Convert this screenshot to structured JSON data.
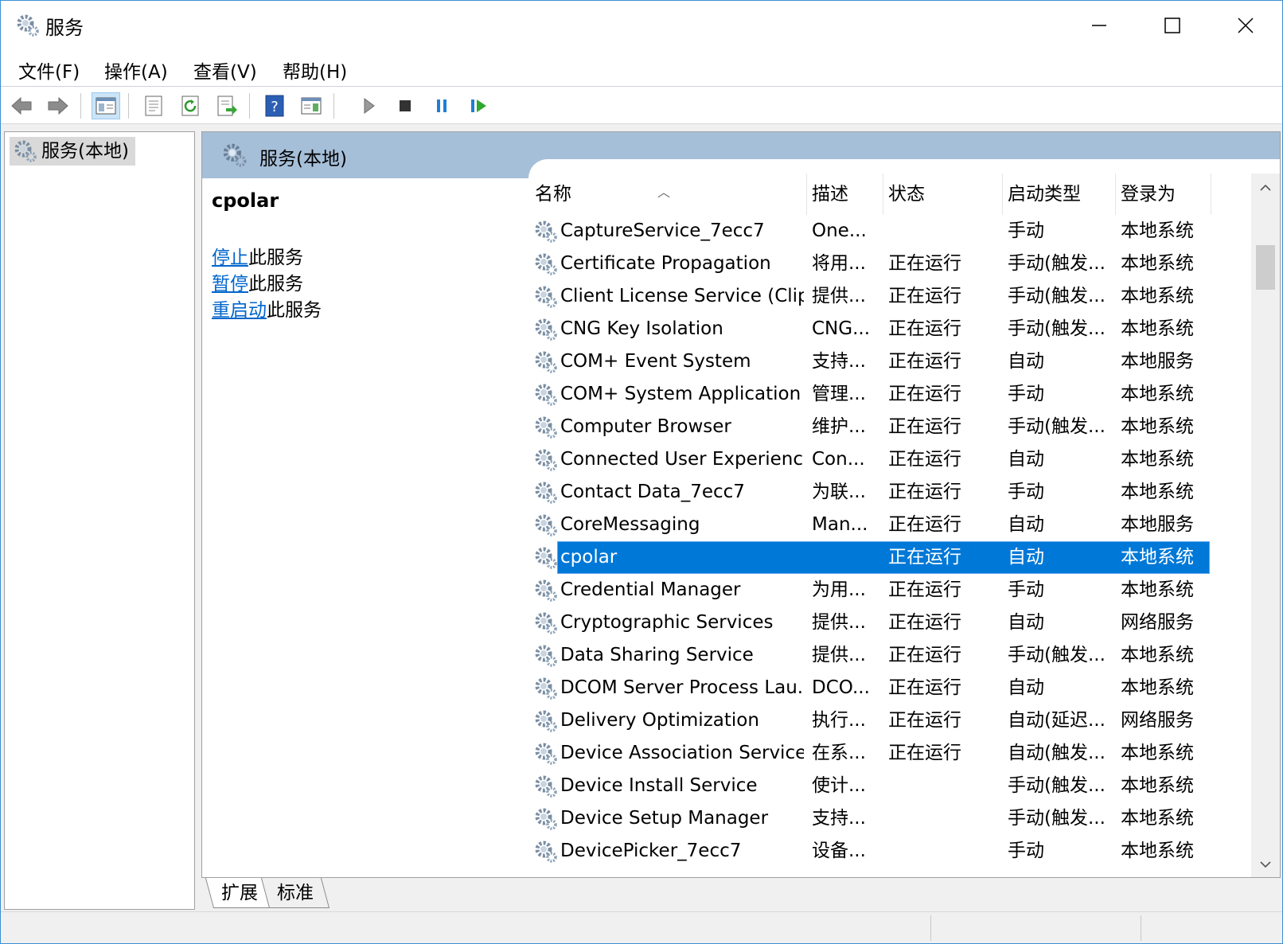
{
  "window": {
    "title": "服务"
  },
  "menu": [
    {
      "label": "文件(F)"
    },
    {
      "label": "操作(A)"
    },
    {
      "label": "查看(V)"
    },
    {
      "label": "帮助(H)"
    }
  ],
  "tree": {
    "root_label": "服务(本地)"
  },
  "content": {
    "header_title": "服务(本地)",
    "selected_service_name": "cpolar",
    "actions": [
      {
        "link": "停止",
        "rest": "此服务"
      },
      {
        "link": "暂停",
        "rest": "此服务"
      },
      {
        "link": "重启动",
        "rest": "此服务"
      }
    ]
  },
  "list": {
    "columns": [
      "名称",
      "描述",
      "状态",
      "启动类型",
      "登录为"
    ],
    "rows": [
      {
        "name": "CaptureService_7ecc7",
        "desc": "One...",
        "status": "",
        "startup": "手动",
        "logon": "本地系统"
      },
      {
        "name": "Certificate Propagation",
        "desc": "将用...",
        "status": "正在运行",
        "startup": "手动(触发...",
        "logon": "本地系统"
      },
      {
        "name": "Client License Service (Clip...",
        "desc": "提供...",
        "status": "正在运行",
        "startup": "手动(触发...",
        "logon": "本地系统"
      },
      {
        "name": "CNG Key Isolation",
        "desc": "CNG...",
        "status": "正在运行",
        "startup": "手动(触发...",
        "logon": "本地系统"
      },
      {
        "name": "COM+ Event System",
        "desc": "支持...",
        "status": "正在运行",
        "startup": "自动",
        "logon": "本地服务"
      },
      {
        "name": "COM+ System Application",
        "desc": "管理...",
        "status": "正在运行",
        "startup": "手动",
        "logon": "本地系统"
      },
      {
        "name": "Computer Browser",
        "desc": "维护...",
        "status": "正在运行",
        "startup": "手动(触发...",
        "logon": "本地系统"
      },
      {
        "name": "Connected User Experienc...",
        "desc": "Con...",
        "status": "正在运行",
        "startup": "自动",
        "logon": "本地系统"
      },
      {
        "name": "Contact Data_7ecc7",
        "desc": "为联...",
        "status": "正在运行",
        "startup": "手动",
        "logon": "本地系统"
      },
      {
        "name": "CoreMessaging",
        "desc": "Man...",
        "status": "正在运行",
        "startup": "自动",
        "logon": "本地服务"
      },
      {
        "name": "cpolar",
        "desc": "",
        "status": "正在运行",
        "startup": "自动",
        "logon": "本地系统",
        "selected": true
      },
      {
        "name": "Credential Manager",
        "desc": "为用...",
        "status": "正在运行",
        "startup": "手动",
        "logon": "本地系统"
      },
      {
        "name": "Cryptographic Services",
        "desc": "提供...",
        "status": "正在运行",
        "startup": "自动",
        "logon": "网络服务"
      },
      {
        "name": "Data Sharing Service",
        "desc": "提供...",
        "status": "正在运行",
        "startup": "手动(触发...",
        "logon": "本地系统"
      },
      {
        "name": "DCOM Server Process Lau...",
        "desc": "DCO...",
        "status": "正在运行",
        "startup": "自动",
        "logon": "本地系统"
      },
      {
        "name": "Delivery Optimization",
        "desc": "执行...",
        "status": "正在运行",
        "startup": "自动(延迟...",
        "logon": "网络服务"
      },
      {
        "name": "Device Association Service",
        "desc": "在系...",
        "status": "正在运行",
        "startup": "自动(触发...",
        "logon": "本地系统"
      },
      {
        "name": "Device Install Service",
        "desc": "使计...",
        "status": "",
        "startup": "手动(触发...",
        "logon": "本地系统"
      },
      {
        "name": "Device Setup Manager",
        "desc": "支持...",
        "status": "",
        "startup": "手动(触发...",
        "logon": "本地系统"
      },
      {
        "name": "DevicePicker_7ecc7",
        "desc": "设备...",
        "status": "",
        "startup": "手动",
        "logon": "本地系统"
      }
    ]
  },
  "tabs": [
    {
      "label": "扩展"
    },
    {
      "label": "标准"
    }
  ],
  "colors": {
    "selection": "#0078d7",
    "link": "#0066cc",
    "header_band": "#a6bfd9"
  }
}
